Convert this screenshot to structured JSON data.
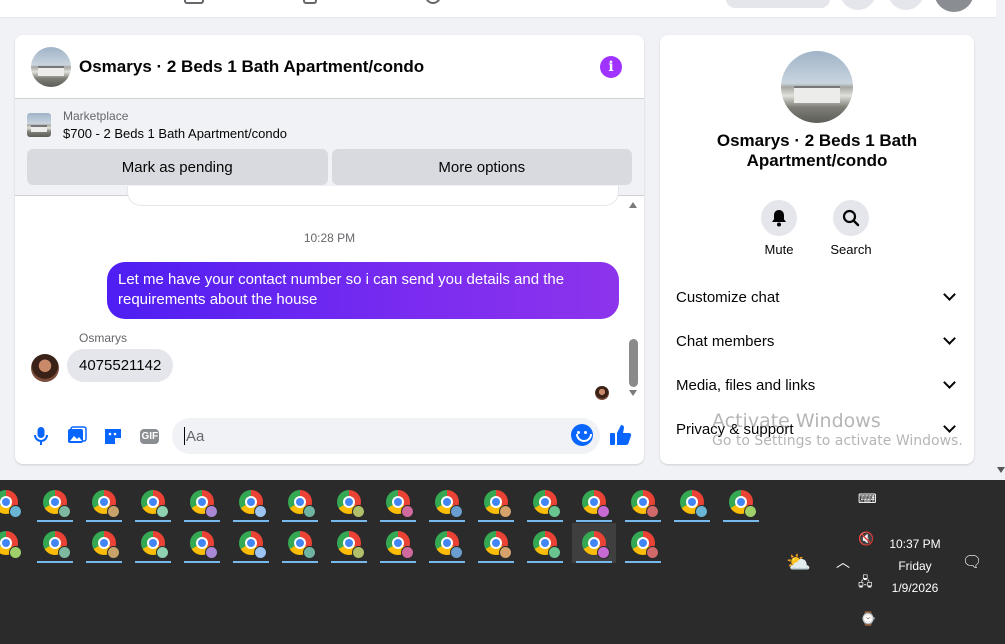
{
  "chat": {
    "title": "Osmarys · 2 Beds 1 Bath Apartment/condo",
    "marketplace_label": "Marketplace",
    "listing": "$700 - 2 Beds 1 Bath Apartment/condo",
    "mark_pending_label": "Mark as pending",
    "more_options_label": "More options",
    "timestamp": "10:28 PM",
    "outgoing_message": "Let me have your contact number so i can send you details and the requirements about the house",
    "sender_name": "Osmarys",
    "incoming_message": "4075521142",
    "input_placeholder": "Aa"
  },
  "side": {
    "title": "Osmarys · 2 Beds 1 Bath Apartment/condo",
    "mute_label": "Mute",
    "search_label": "Search",
    "rows": [
      "Customize chat",
      "Chat members",
      "Media, files and links",
      "Privacy & support"
    ]
  },
  "watermark": {
    "line1": "Activate Windows",
    "line2": "Go to Settings to activate Windows."
  },
  "taskbar": {
    "time": "10:37 PM",
    "day": "Friday",
    "date": "1/9/2026",
    "accent_color": "#76b9ed"
  },
  "icons": {
    "info": "info-icon",
    "mic": "microphone-icon",
    "photo": "photo-icon",
    "sticker": "sticker-icon",
    "gif": "gif-icon",
    "emoji": "emoji-icon",
    "like": "thumbs-up-icon",
    "mute": "bell-icon",
    "search": "search-icon"
  },
  "colors": {
    "messenger_blue": "#0866ff",
    "info_purple": "#a033ff",
    "bubble_gradient_start": "#4e1ef2",
    "bubble_gradient_end": "#8d34ec"
  }
}
